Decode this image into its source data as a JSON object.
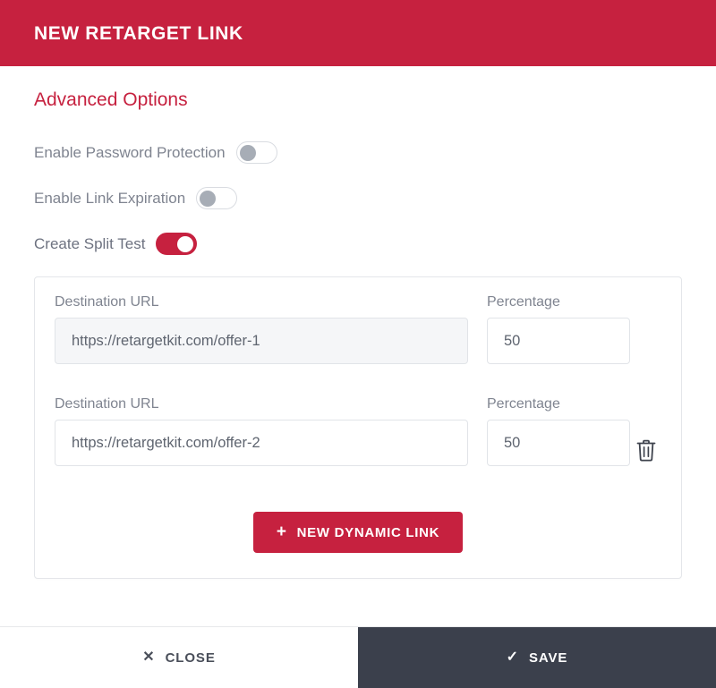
{
  "header": {
    "title": "NEW RETARGET LINK"
  },
  "colors": {
    "brand_red": "#c6213f",
    "footer_dark": "#3b404c",
    "label_gray": "#7f8490",
    "input_disabled_bg": "#f5f6f8"
  },
  "body": {
    "section_heading": "Advanced Options",
    "toggles": [
      {
        "label": "Enable Password Protection",
        "state": "off"
      },
      {
        "label": "Enable Link Expiration",
        "state": "off"
      },
      {
        "label": "Create Split Test",
        "state": "on"
      }
    ]
  },
  "split_test": {
    "url_label": "Destination URL",
    "percentage_label": "Percentage",
    "rows": [
      {
        "url_value": "https://retargetkit.com/offer-1",
        "percentage_value": "50",
        "deletable": false
      },
      {
        "url_value": "https://retargetkit.com/offer-2",
        "percentage_value": "50",
        "deletable": true
      }
    ],
    "delete_icon": "trash-icon",
    "add_button": {
      "icon": "plus-icon",
      "plus": "+",
      "label": "NEW DYNAMIC LINK"
    }
  },
  "footer": {
    "close": {
      "icon": "close-x-icon",
      "glyph": "✕",
      "label": "CLOSE"
    },
    "save": {
      "icon": "check-icon",
      "glyph": "✓",
      "label": "SAVE"
    }
  }
}
